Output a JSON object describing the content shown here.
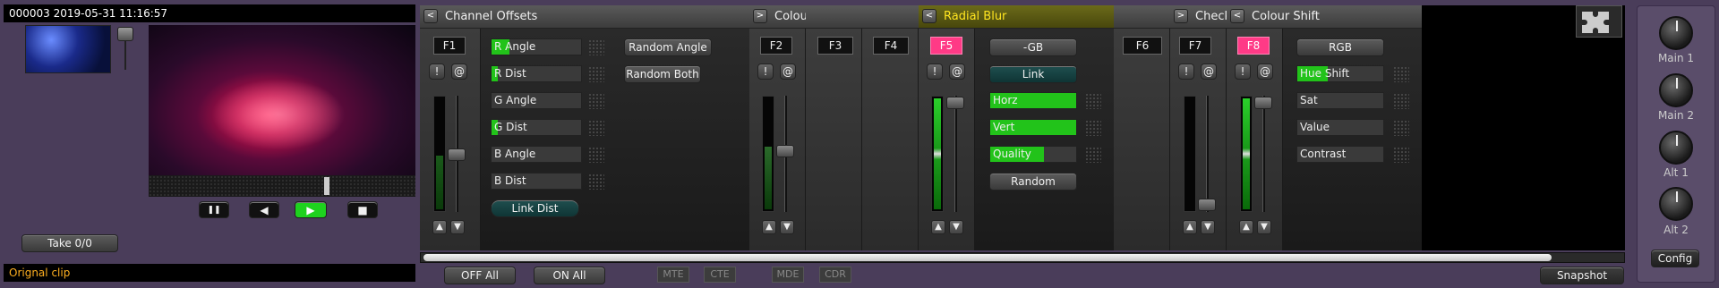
{
  "preview": {
    "timestamp": "000003 2019-05-31 11:16:57",
    "take_button": "Take 0/0",
    "clip_name": "Orignal clip",
    "transport": {
      "pause": "❚❚",
      "back": "◀",
      "play": "▶",
      "stop": "■"
    }
  },
  "panels": {
    "channel_offsets": {
      "title": "Channel Offsets",
      "fkey": "F1",
      "params": [
        {
          "label": "R Angle",
          "level": 0.2
        },
        {
          "label": "R Dist",
          "level": 0.07
        },
        {
          "label": "G Angle",
          "level": 0
        },
        {
          "label": "G Dist",
          "level": 0.07
        },
        {
          "label": "B Angle",
          "level": 0
        },
        {
          "label": "B Dist",
          "level": 0
        }
      ],
      "buttons": {
        "random_angle": "Random Angle",
        "random_both": "Random Both",
        "link_dist": "Link Dist"
      }
    },
    "colour": {
      "title": "Colou",
      "fkey": "F2"
    },
    "f3": {
      "fkey": "F3"
    },
    "f4": {
      "fkey": "F4"
    },
    "radial_blur": {
      "title": "Radial Blur",
      "fkey": "F5",
      "buttons": {
        "gb": "-GB",
        "link": "Link",
        "random": "Random"
      },
      "params": [
        {
          "label": "Horz",
          "level": 1.0
        },
        {
          "label": "Vert",
          "level": 1.0
        },
        {
          "label": "Quality",
          "level": 0.62
        }
      ]
    },
    "f6": {
      "fkey": "F6"
    },
    "check": {
      "title": "Check",
      "fkey": "F7"
    },
    "colour_shift": {
      "title": "Colour Shift",
      "fkey": "F8",
      "buttons": {
        "rgb": "RGB"
      },
      "params": [
        {
          "label": "Hue Shift",
          "level": 0.35
        },
        {
          "label": "Sat",
          "level": 0
        },
        {
          "label": "Value",
          "level": 0
        },
        {
          "label": "Contrast",
          "level": 0
        }
      ]
    }
  },
  "common": {
    "collapse": "<",
    "expand": ">",
    "bang": "!",
    "at": "@",
    "up": "▲",
    "down": "▼"
  },
  "bottom_bar": {
    "off_all": "OFF All",
    "on_all": "ON All",
    "mte": "MTE",
    "cte": "CTE",
    "mde": "MDE",
    "cdr": "CDR",
    "snapshot": "Snapshot"
  },
  "right_panel": {
    "main1": "Main 1",
    "main2": "Main 2",
    "alt1": "Alt 1",
    "alt2": "Alt 2",
    "config": "Config"
  },
  "colors": {
    "active_fkey": "#ff3a86",
    "level": "#22c31a",
    "highlight_title": "#ffe520",
    "clip_name": "#ffb020"
  }
}
